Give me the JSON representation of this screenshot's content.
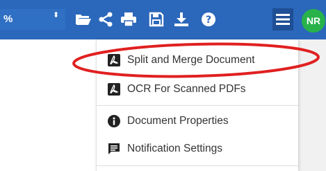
{
  "toolbar": {
    "zoom_value": "%",
    "zoom_arrows": "⬍",
    "icons": [
      "folder-open-icon",
      "share-icon",
      "print-icon",
      "save-icon",
      "download-icon",
      "help-icon",
      "menu-icon"
    ],
    "avatar_initials": "NR"
  },
  "menu": {
    "items": [
      {
        "label": "Split and Merge Document",
        "icon": "pdf-icon"
      },
      {
        "label": "OCR For Scanned PDFs",
        "icon": "pdf-icon"
      },
      {
        "label": "Document Properties",
        "icon": "info-icon"
      },
      {
        "label": "Notification Settings",
        "icon": "notification-icon"
      }
    ]
  },
  "colors": {
    "toolbar": "#2b67ba",
    "menu_button_active": "#1e4f96",
    "avatar": "#27b24a",
    "highlight": "#e02020"
  }
}
